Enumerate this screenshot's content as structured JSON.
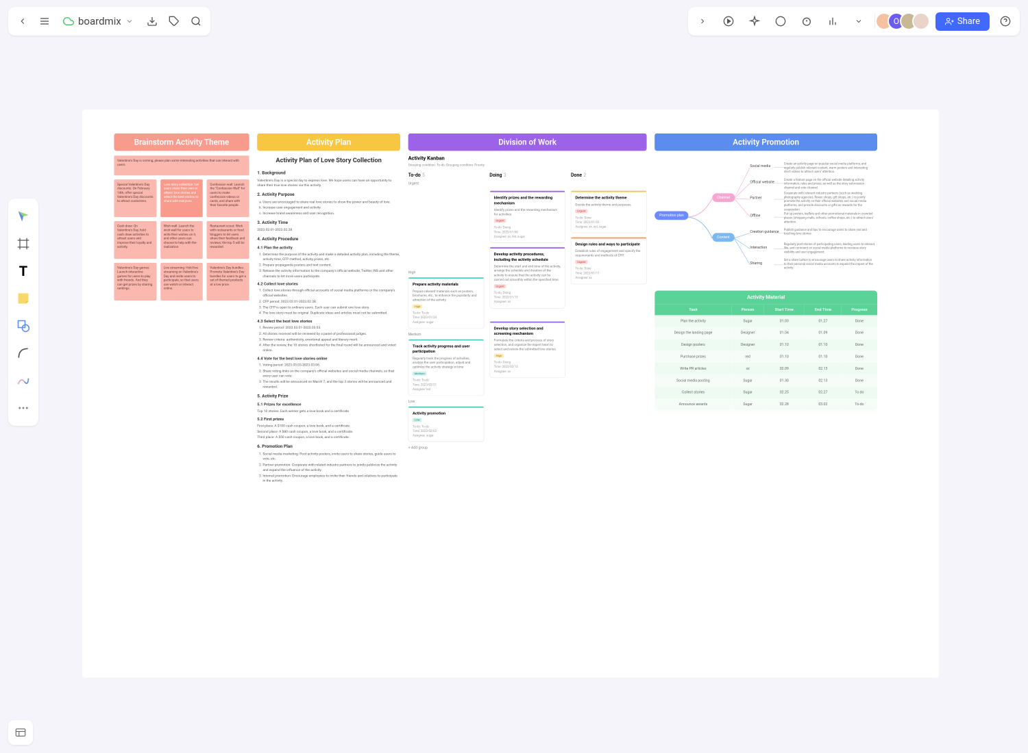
{
  "brand": "boardmix",
  "share": "Share",
  "headers": {
    "h1": "Brainstorm Activity Theme",
    "h2": "Activity Plan",
    "h3": "Division of Work",
    "h4": "Activity Promotion"
  },
  "notes": [
    "Valentine's Day is coming, please plan some interesting activities that can interact with users.",
    "Special Valentine's Day discounts: On February 14th, offer special Valentine's Day discounts to attract customers.",
    "Love story collection: Let users share their own or others' love stories and select the best stories to share with everyone.",
    "Confession wall: Launch the \"Confession Wall\" for users to make confession videos or cards, and share with their favorite people.",
    "Cash draw: On Valentine's Day, hold cash draw activities to attract users and improve their loyalty and activity.",
    "Wish wall: Launch the wish wall for users to write their wishes on it, and other users can choose to help with the realization.",
    "Restaurant scout: Work with restaurants or food bloggers to let users share their feedback and reviews; the top 5 will be rewarded.",
    "Valentine's Day games: Launch interactive games for users to play with friends. And they can get prizes by sharing rankings.",
    "Live streaming: Hold live streaming on Valentine's Day and invite users to participate, so that users can watch or interact online.",
    "Valentine's Day bundles: Promote Valentine's Day bundles for users to get a set of themed products at a low price."
  ],
  "doc": {
    "title": "Activity Plan of Love Story Collection",
    "s1": "1. Background",
    "p1": "Valentine's Day is a special day to express love. We hope users can have an opportunity to share their true love stories via this activity.",
    "s2": "2. Activity Purpose",
    "a2a": "Users are encouraged to share real love stories to show the power and beauty of love.",
    "a2b": "Increase user engagement and activity.",
    "a2c": "Increase brand awareness and user recognition.",
    "s3": "3. Activity Time",
    "p3": "2023.02.01-2023.02.28",
    "s4": "4. Activity Procedure",
    "s41": "4.1 Plan the activity",
    "a41a": "Determine the purpose of the activity and make a detailed activity plan, including the theme, activity time, CFP method, activity prizes, etc.",
    "a41b": "Prepare propaganda posters and text content.",
    "a41c": "Release the activity information to the company's official website, Twitter, INS and other channels to let more users participate.",
    "s42": "4.2 Collect love stories",
    "a42a": "Collect love stories through official accounts of social media platforms or the company's official websites.",
    "a42b": "CFP period: 2023.02.01-2023.02.28.",
    "a42c": "The CFP is open to ordinary users. Each user can submit one love story.",
    "a42d": "The love story must be original. Duplicate ideas and articles must not be submitted.",
    "s43": "4.3 Select the best love stories",
    "a43a": "Review period: 2023.03.01-2023.03.03.",
    "a43b": "All stories received will be reviewed by a panel of professional judges.",
    "a43c": "Review criteria: authenticity, emotional appeal and literary merit.",
    "a43d": "After the review, the 10 stories shortlisted for the final round will be announced and voted online.",
    "s44": "4.4 Vote for the best love stories online",
    "a44a": "Voting period: 2023.03.03-2023.03.06.",
    "a44b": "Share voting links on the company's official websites and social media channels, so that every user can vote.",
    "a44c": "The results will be announced on March 7, and the top 3 stories will be announced and rewarded.",
    "s5": "5. Activity Prize",
    "s51": "5.1 Prizes for excellence",
    "p51": "Top 10 stories: Each winner gets a love book and a certificate.",
    "s52": "5.2 First prizes",
    "p52a": "First place: A $100 cash coupon, a love book, and a certificate.",
    "p52b": "Second place: A $80 cash coupon, a love book, and a certificate.",
    "p52c": "Third place: A $50 cash coupon, a love book, and a certificate.",
    "s6": "6. Promotion Plan",
    "a6a": "Social media marketing: Post activity posters, invite users to share stories, guide users to vote, etc.",
    "a6b": "Partner promotion: Cooperate with related industry partners to jointly publicize the activity and expand the influence of the activity.",
    "a6c": "Internal promotion: Encourage employees to invite their friends and relatives to participate in the activity."
  },
  "kanban": {
    "title": "Activity Kanban",
    "sub": "Grouping condition: To-do; Grouping condition: Priority",
    "cols": [
      "To-do",
      "Doing",
      "Done"
    ],
    "counts": [
      "5",
      "3",
      "2"
    ],
    "prio": {
      "urgent": "Urgent",
      "high": "High",
      "medium": "Medium",
      "low": "Low"
    },
    "cards": {
      "c1": {
        "title": "Identify prizes and the rewarding mechanism",
        "desc": "Identify prizes and the rewarding mechanism for activities.",
        "tag": "Urgent",
        "m1": "To-do: Doing",
        "m2": "Time: 2023/01/08",
        "m3": "Assignee: xx, red, sugar"
      },
      "c2": {
        "title": "Determine the activity theme",
        "desc": "Decide the activity theme and purposes.",
        "tag": "Urgent",
        "m1": "To-do: Done",
        "m2": "Time: 2023/01/03",
        "m3": "Assignee: xx, red, sugar"
      },
      "c3": {
        "title": "Develop activity procedures, including the activity schedule",
        "desc": "Determine the start and end time of the activity, arrange the schedule and duration of the activity to ensure that the activity can be carried out smoothly within the specified time.",
        "tag": "Urgent",
        "m1": "To-do: Doing",
        "m2": "Time: 2023/01/13",
        "m3": "Assignee: xx"
      },
      "c4": {
        "title": "Design rules and ways to participate",
        "desc": "Establish rules of engagement and specify the requirements and methods of CFP.",
        "tag": "Urgent",
        "m1": "To-do: Done",
        "m2": "Time: 2023/01/17",
        "m3": "Assignee: xx"
      },
      "c5": {
        "title": "Prepare activity materials",
        "desc": "Prepare relevant materials such as posters, brochures, etc., to enhance the popularity and attraction of the activity.",
        "tag": "High",
        "m1": "To-do: To-do",
        "m2": "Time: 2023/01/24",
        "m3": "Assignee: sugar"
      },
      "c6": {
        "title": "Develop story selection and screening mechanism",
        "desc": "Formulate the criteria and process of story selection, and organize the expert team to select and review the submitted love stories.",
        "tag": "High",
        "m1": "To-do: Doing",
        "m2": "Time: 2023/02/13",
        "m3": "Assignee: xx"
      },
      "c7": {
        "title": "Track activity progress and user participation",
        "desc": "Regularly track the progress of activities, analyze the user participation, adjust and optimize the activity strategy in time.",
        "tag": "Medium",
        "m1": "To-do: To-do",
        "m2": "Time: 2023/02/21",
        "m3": "Assignee: red"
      },
      "c8": {
        "title": "Activity promotion",
        "tag": "Low",
        "m1": "To-do: To-do",
        "m2": "Time: 2023/02/02",
        "m3": "Assignee: sugar"
      }
    },
    "addGroup": "+ Add group"
  },
  "mind": {
    "root": "Promotion plan",
    "n1": "Channel",
    "n2": "Content",
    "leaves": [
      "Social media",
      "Official website",
      "Partner",
      "Offline",
      "Creation guidance",
      "Interaction",
      "Sharing"
    ],
    "descs": [
      "Create an activity page on popular social media platforms, and regularly publish relevant content, warm posters and interesting short videos to attract users' attention.",
      "Create a feature page on the official website detailing activity information, rules and prizes, as well as the story submission channel and vote channel.",
      "Cooperate with relevant industry partners (such as wedding photography agencies, flower shops, gift shops, etc.) to jointly promote the activity on their official websites and social media platforms, and provide discounts or gifts as rewards for the cooperation.",
      "Put up posters, leaflets and other promotional materials in crowded places (shopping malls, schools, coffee shops, etc.) to attract users' attention.",
      "Publish guidance and tips to encourage users to share real and touching love stories.",
      "Regularly post stories of participating users, leading users to interact, like, and comment on social media platforms to increase story visibility and user engagement.",
      "Set a share button to encourage users to share activity information to their personal social media accounts to expand the impact of the activity."
    ]
  },
  "table": {
    "title": "Activity Material",
    "head": [
      "Task",
      "Person",
      "Start Time",
      "End Time",
      "Progress"
    ],
    "rows": [
      [
        "Plan the activity",
        "Sugar",
        "01.03",
        "01.27",
        "Done"
      ],
      [
        "Design the landing page",
        "Designer",
        "01.04",
        "01.09",
        "Done"
      ],
      [
        "Design posters",
        "Designer",
        "01.10",
        "01.10",
        "Done"
      ],
      [
        "Purchase prizes",
        "red",
        "01.10",
        "01.10",
        "Done"
      ],
      [
        "Write PR articles",
        "xx",
        "02.09",
        "02.13",
        "Done"
      ],
      [
        "Social media posting",
        "Sugar",
        "01.30",
        "02.13",
        "Done"
      ],
      [
        "Collect stories",
        "Sugar",
        "02.25",
        "02.27",
        "To do"
      ],
      [
        "Announce awards",
        "Sugar",
        "02.28",
        "03.02",
        "To-do"
      ]
    ]
  }
}
